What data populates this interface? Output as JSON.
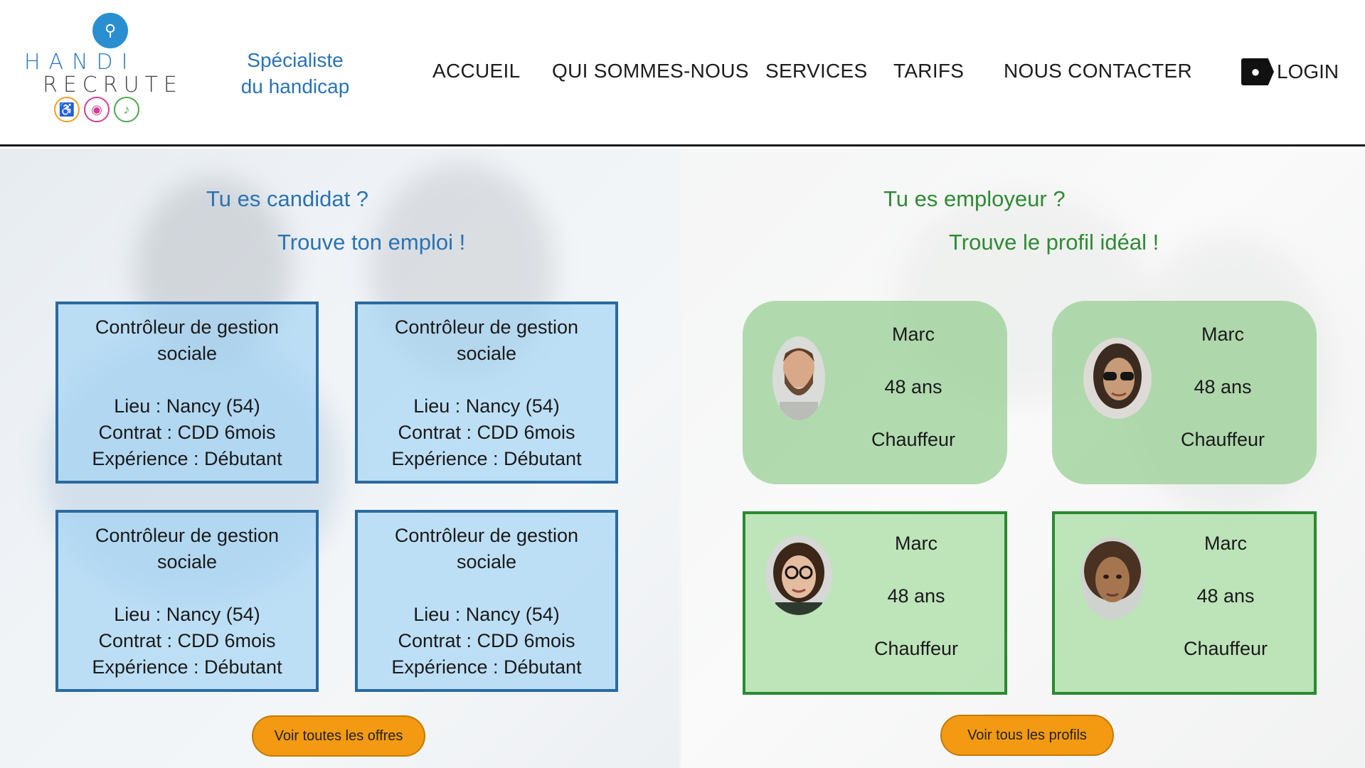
{
  "brand": {
    "logo_line1": "HANDI",
    "logo_line2": "RECRUTE",
    "tagline": "Spécialiste du handicap",
    "accent": "#2a73b2"
  },
  "nav": {
    "items": [
      "ACCUEIL",
      "QUI SOMMES-NOUS",
      "SERVICES",
      "TARIFS",
      "NOUS CONTACTER"
    ],
    "login_label": "LOGIN"
  },
  "candidate": {
    "title": "Tu es candidat ?",
    "subtitle": "Trouve ton emploi !",
    "offers": [
      {
        "title": "Contrôleur de gestion sociale",
        "lieu": "Lieu : Nancy (54)",
        "contrat": "Contrat : CDD 6mois",
        "experience": "Expérience : Débutant"
      },
      {
        "title": "Contrôleur de gestion sociale",
        "lieu": "Lieu : Nancy (54)",
        "contrat": "Contrat : CDD 6mois",
        "experience": "Expérience : Débutant"
      },
      {
        "title": "Contrôleur de gestion sociale",
        "lieu": "Lieu : Nancy (54)",
        "contrat": "Contrat : CDD 6mois",
        "experience": "Expérience : Débutant"
      },
      {
        "title": "Contrôleur de gestion sociale",
        "lieu": "Lieu : Nancy (54)",
        "contrat": "Contrat : CDD 6mois",
        "experience": "Expérience : Débutant"
      }
    ],
    "cta_label": "Voir toutes les offres"
  },
  "employer": {
    "title": "Tu es employeur ?",
    "subtitle": "Trouve le profil idéal !",
    "profiles": [
      {
        "name": "Marc",
        "age": "48 ans",
        "job": "Chauffeur"
      },
      {
        "name": "Marc",
        "age": "48 ans",
        "job": "Chauffeur"
      },
      {
        "name": "Marc",
        "age": "48 ans",
        "job": "Chauffeur"
      },
      {
        "name": "Marc",
        "age": "48 ans",
        "job": "Chauffeur"
      }
    ],
    "cta_label": "Voir tous les profils"
  },
  "colors": {
    "cta": "#f39a12",
    "job_border": "#2a6aa0",
    "profile_border": "#2a8a30",
    "employer_title": "#2f8a35"
  },
  "icons": [
    "magnifier-people-icon",
    "wheelchair-icon",
    "eye-icon",
    "ear-icon",
    "user-login-icon"
  ]
}
